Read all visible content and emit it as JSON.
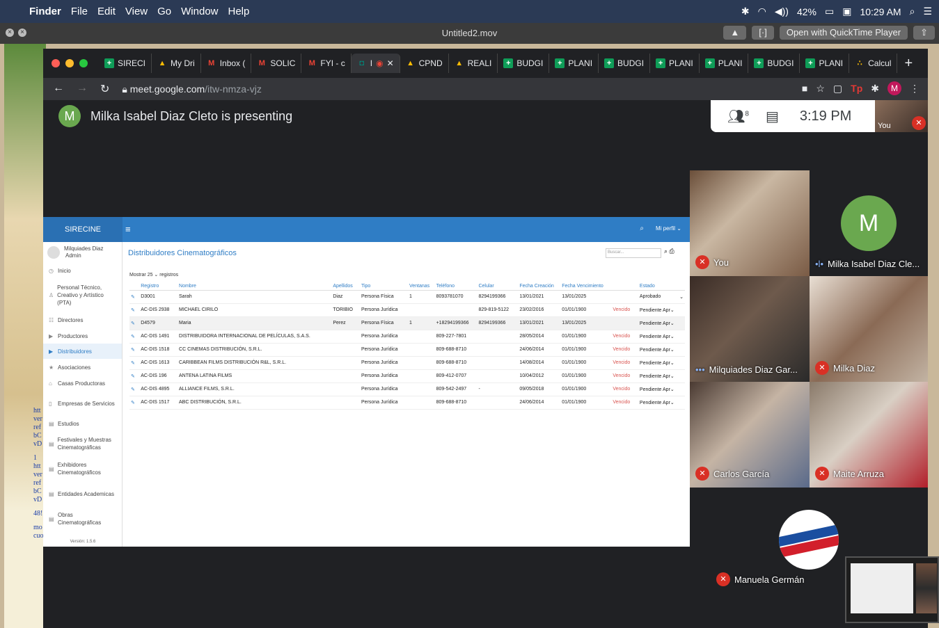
{
  "menubar": {
    "app": "Finder",
    "items": [
      "File",
      "Edit",
      "View",
      "Go",
      "Window",
      "Help"
    ],
    "battery": "42%",
    "clock": "10:29 AM"
  },
  "quicktime": {
    "title": "Untitled2.mov",
    "open_with": "Open with QuickTime Player"
  },
  "chrome": {
    "tabs": [
      {
        "label": "SIRECI",
        "icon": "sheets-icon"
      },
      {
        "label": "My Dri",
        "icon": "drive-icon"
      },
      {
        "label": "Inbox (",
        "icon": "gmail-icon"
      },
      {
        "label": "SOLIC",
        "icon": "gmail-icon"
      },
      {
        "label": "FYI - c",
        "icon": "gmail-icon"
      },
      {
        "label": "I",
        "icon": "meet-icon"
      },
      {
        "label": "CPND",
        "icon": "drive-icon"
      },
      {
        "label": "REALI",
        "icon": "drive-icon"
      },
      {
        "label": "BUDGI",
        "icon": "sheets-icon"
      },
      {
        "label": "PLANI",
        "icon": "sheets-icon"
      },
      {
        "label": "BUDGI",
        "icon": "sheets-icon"
      },
      {
        "label": "PLANI",
        "icon": "sheets-icon"
      },
      {
        "label": "PLANI",
        "icon": "sheets-icon"
      },
      {
        "label": "BUDGI",
        "icon": "sheets-icon"
      },
      {
        "label": "PLANI",
        "icon": "sheets-icon"
      },
      {
        "label": "Calcul",
        "icon": "calc-icon"
      }
    ],
    "url_host": "meet.google.com",
    "url_path": "/itw-nmza-vjz",
    "profile_initial": "M"
  },
  "meet": {
    "presenter_initial": "M",
    "presenter_text": "Milka Isabel Diaz Cleto is presenting",
    "participants_count": "8",
    "time": "3:19 PM",
    "self_label": "You",
    "participants": [
      {
        "name": "You"
      },
      {
        "name": "Milka Isabel Diaz Cle...",
        "initial": "M"
      },
      {
        "name": "Milquiades Diaz Gar..."
      },
      {
        "name": "Milka Diaz"
      },
      {
        "name": "Carlos García"
      },
      {
        "name": "Maite Arruza"
      },
      {
        "name": "Manuela Germán"
      }
    ]
  },
  "app": {
    "brand": "SIRECINE",
    "profile_menu": "Mi perfil",
    "user_name": "Milquiades Diaz",
    "user_role": "Admin",
    "menu": [
      "Inicio",
      "Personal Técnico, Creativo y Artístico (PTA)",
      "Directores",
      "Productores",
      "Distribuidores",
      "Asociaciones",
      "Casas Productoras",
      "Empresas de Servicios",
      "Estudios",
      "Festivales y Muestras Cinematográficas",
      "Exhibidores Cinematográficos",
      "Entidades Academicas",
      "Obras Cinematográficas"
    ],
    "version": "Versión: 1.5.6",
    "page_title": "Distribuidores Cinematográficos",
    "search_placeholder": "Buscar...",
    "show_prefix": "Mostrar",
    "show_count": "25",
    "show_suffix": "registros",
    "columns": [
      "Registro",
      "Nombre",
      "Apellidos",
      "Tipo",
      "Ventanas",
      "Teléfono",
      "Celular",
      "Fecha Creación",
      "Fecha Vencimiento",
      "",
      "Estado"
    ],
    "rows": [
      [
        "D3001",
        "Sarah",
        "Diaz",
        "Persona Física",
        "1",
        "8093781070",
        "8294199366",
        "13/01/2021",
        "13/01/2025",
        "",
        "Aprobado"
      ],
      [
        "AC-DIS 2938",
        "MICHAEL CIRILO",
        "TORIBIO",
        "Persona Jurídica",
        "",
        "",
        "829-819-5122",
        "23/02/2016",
        "01/01/1900",
        "Vencido",
        "Pendiente Apr"
      ],
      [
        "D4579",
        "Maria",
        "Perez",
        "Persona Física",
        "1",
        "+18294199366",
        "8294199366",
        "13/01/2021",
        "13/01/2025",
        "",
        "Pendiente Apr"
      ],
      [
        "AC-DIS 1491",
        "DISTRIBUIDORA INTERNACIONAL DE PELÍCULAS, S.A.S.",
        "",
        "Persona Jurídica",
        "",
        "809-227-7801",
        "",
        "28/05/2014",
        "01/01/1900",
        "Vencido",
        "Pendiente Apr"
      ],
      [
        "AC-DIS 1518",
        "CC CINEMAS DISTRIBUCIÓN, S.R.L.",
        "",
        "Persona Jurídica",
        "",
        "809-688-8710",
        "",
        "24/06/2014",
        "01/01/1900",
        "Vencido",
        "Pendiente Apr"
      ],
      [
        "AC-DIS 1613",
        "CARIBBEAN FILMS DISTRIBUCIÓN R&L, S.R.L.",
        "",
        "Persona Jurídica",
        "",
        "809-688-8710",
        "",
        "14/08/2014",
        "01/01/1900",
        "Vencido",
        "Pendiente Apr"
      ],
      [
        "AC-DIS 196",
        "ANTENA LATINA FILMS",
        "",
        "Persona Jurídica",
        "",
        "809-412-0707",
        "",
        "10/04/2012",
        "01/01/1900",
        "Vencido",
        "Pendiente Apr"
      ],
      [
        "AC-DIS 4895",
        "ALLIANCE FILMS, S.R.L.",
        "",
        "Persona Jurídica",
        "",
        "809-542-2497",
        "-",
        "09/05/2018",
        "01/01/1900",
        "Vencido",
        "Pendiente Apr"
      ],
      [
        "AC-DIS 1517",
        "ABC DISTRIBUCIÓN, S.R.L.",
        "",
        "Persona Jurídica",
        "",
        "809-688-8710",
        "",
        "24/06/2014",
        "01/01/1900",
        "Vencido",
        "Pendiente Apr"
      ]
    ]
  },
  "desktop_links": [
    "htt",
    "ver",
    "ref",
    "bC",
    "vD",
    "1",
    "htt",
    "ver",
    "ref",
    "bC",
    "vD",
    "48!",
    "mo",
    "cuo"
  ]
}
